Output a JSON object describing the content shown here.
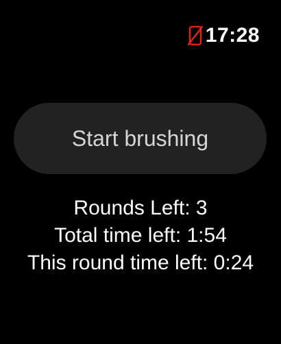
{
  "status": {
    "time": "17:28",
    "phone_icon": "phone-disconnected-icon",
    "phone_icon_color": "#e0241c"
  },
  "main": {
    "start_button_label": "Start brushing",
    "rounds_left": "Rounds Left: 3",
    "total_time_left": "Total time left: 1:54",
    "round_time_left": "This round time left: 0:24"
  },
  "colors": {
    "background": "#000000",
    "button_background": "#222222",
    "button_text": "#d6d6d6",
    "text": "#ffffff"
  }
}
